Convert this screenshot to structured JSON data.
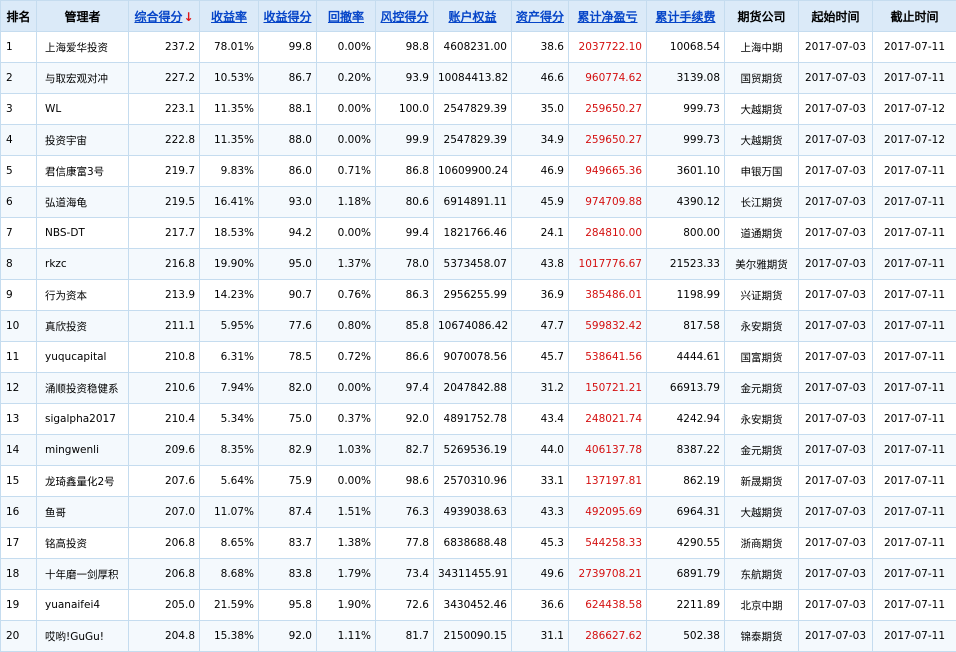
{
  "headers": {
    "rank": "排名",
    "manager": "管理者",
    "total_score": "综合得分",
    "sort_arrow": "↓",
    "return_rate": "收益率",
    "return_score": "收益得分",
    "drawdown": "回撤率",
    "risk_score": "风控得分",
    "equity": "账户权益",
    "asset_score": "资产得分",
    "net_profit": "累计净盈亏",
    "fees": "累计手续费",
    "company": "期货公司",
    "start_time": "起始时间",
    "end_time": "截止时间"
  },
  "colors": {
    "header_bg": "#dbeaf8",
    "link": "#0645c8",
    "sort_arrow": "#e01818",
    "profit": "#d41010",
    "grid": "#c5dcef"
  },
  "rows": [
    {
      "rank": "1",
      "manager": "上海爱华投资",
      "total_score": "237.2",
      "return_rate": "78.01%",
      "return_score": "99.8",
      "drawdown": "0.00%",
      "risk_score": "98.8",
      "equity": "4608231.00",
      "asset_score": "38.6",
      "net_profit": "2037722.10",
      "fees": "10068.54",
      "company": "上海中期",
      "start": "2017-07-03",
      "end": "2017-07-11"
    },
    {
      "rank": "2",
      "manager": "与取宏观对冲",
      "total_score": "227.2",
      "return_rate": "10.53%",
      "return_score": "86.7",
      "drawdown": "0.20%",
      "risk_score": "93.9",
      "equity": "10084413.82",
      "asset_score": "46.6",
      "net_profit": "960774.62",
      "fees": "3139.08",
      "company": "国贸期货",
      "start": "2017-07-03",
      "end": "2017-07-11"
    },
    {
      "rank": "3",
      "manager": "WL",
      "total_score": "223.1",
      "return_rate": "11.35%",
      "return_score": "88.1",
      "drawdown": "0.00%",
      "risk_score": "100.0",
      "equity": "2547829.39",
      "asset_score": "35.0",
      "net_profit": "259650.27",
      "fees": "999.73",
      "company": "大越期货",
      "start": "2017-07-03",
      "end": "2017-07-12"
    },
    {
      "rank": "4",
      "manager": "投资宇宙",
      "total_score": "222.8",
      "return_rate": "11.35%",
      "return_score": "88.0",
      "drawdown": "0.00%",
      "risk_score": "99.9",
      "equity": "2547829.39",
      "asset_score": "34.9",
      "net_profit": "259650.27",
      "fees": "999.73",
      "company": "大越期货",
      "start": "2017-07-03",
      "end": "2017-07-12"
    },
    {
      "rank": "5",
      "manager": "君信康富3号",
      "total_score": "219.7",
      "return_rate": "9.83%",
      "return_score": "86.0",
      "drawdown": "0.71%",
      "risk_score": "86.8",
      "equity": "10609900.24",
      "asset_score": "46.9",
      "net_profit": "949665.36",
      "fees": "3601.10",
      "company": "申银万国",
      "start": "2017-07-03",
      "end": "2017-07-11"
    },
    {
      "rank": "6",
      "manager": "弘道海龟",
      "total_score": "219.5",
      "return_rate": "16.41%",
      "return_score": "93.0",
      "drawdown": "1.18%",
      "risk_score": "80.6",
      "equity": "6914891.11",
      "asset_score": "45.9",
      "net_profit": "974709.88",
      "fees": "4390.12",
      "company": "长江期货",
      "start": "2017-07-03",
      "end": "2017-07-11"
    },
    {
      "rank": "7",
      "manager": "NBS-DT",
      "total_score": "217.7",
      "return_rate": "18.53%",
      "return_score": "94.2",
      "drawdown": "0.00%",
      "risk_score": "99.4",
      "equity": "1821766.46",
      "asset_score": "24.1",
      "net_profit": "284810.00",
      "fees": "800.00",
      "company": "道通期货",
      "start": "2017-07-03",
      "end": "2017-07-11"
    },
    {
      "rank": "8",
      "manager": "rkzc",
      "total_score": "216.8",
      "return_rate": "19.90%",
      "return_score": "95.0",
      "drawdown": "1.37%",
      "risk_score": "78.0",
      "equity": "5373458.07",
      "asset_score": "43.8",
      "net_profit": "1017776.67",
      "fees": "21523.33",
      "company": "美尔雅期货",
      "start": "2017-07-03",
      "end": "2017-07-11"
    },
    {
      "rank": "9",
      "manager": "行为资本",
      "total_score": "213.9",
      "return_rate": "14.23%",
      "return_score": "90.7",
      "drawdown": "0.76%",
      "risk_score": "86.3",
      "equity": "2956255.99",
      "asset_score": "36.9",
      "net_profit": "385486.01",
      "fees": "1198.99",
      "company": "兴证期货",
      "start": "2017-07-03",
      "end": "2017-07-11"
    },
    {
      "rank": "10",
      "manager": "真欣投资",
      "total_score": "211.1",
      "return_rate": "5.95%",
      "return_score": "77.6",
      "drawdown": "0.80%",
      "risk_score": "85.8",
      "equity": "10674086.42",
      "asset_score": "47.7",
      "net_profit": "599832.42",
      "fees": "817.58",
      "company": "永安期货",
      "start": "2017-07-03",
      "end": "2017-07-11"
    },
    {
      "rank": "11",
      "manager": "yuqucapital",
      "total_score": "210.8",
      "return_rate": "6.31%",
      "return_score": "78.5",
      "drawdown": "0.72%",
      "risk_score": "86.6",
      "equity": "9070078.56",
      "asset_score": "45.7",
      "net_profit": "538641.56",
      "fees": "4444.61",
      "company": "国富期货",
      "start": "2017-07-03",
      "end": "2017-07-11"
    },
    {
      "rank": "12",
      "manager": "涌顺投资稳健系",
      "total_score": "210.6",
      "return_rate": "7.94%",
      "return_score": "82.0",
      "drawdown": "0.00%",
      "risk_score": "97.4",
      "equity": "2047842.88",
      "asset_score": "31.2",
      "net_profit": "150721.21",
      "fees": "66913.79",
      "company": "金元期货",
      "start": "2017-07-03",
      "end": "2017-07-11"
    },
    {
      "rank": "13",
      "manager": "sigalpha2017",
      "total_score": "210.4",
      "return_rate": "5.34%",
      "return_score": "75.0",
      "drawdown": "0.37%",
      "risk_score": "92.0",
      "equity": "4891752.78",
      "asset_score": "43.4",
      "net_profit": "248021.74",
      "fees": "4242.94",
      "company": "永安期货",
      "start": "2017-07-03",
      "end": "2017-07-11"
    },
    {
      "rank": "14",
      "manager": "mingwenli",
      "total_score": "209.6",
      "return_rate": "8.35%",
      "return_score": "82.9",
      "drawdown": "1.03%",
      "risk_score": "82.7",
      "equity": "5269536.19",
      "asset_score": "44.0",
      "net_profit": "406137.78",
      "fees": "8387.22",
      "company": "金元期货",
      "start": "2017-07-03",
      "end": "2017-07-11"
    },
    {
      "rank": "15",
      "manager": "龙琦鑫量化2号",
      "total_score": "207.6",
      "return_rate": "5.64%",
      "return_score": "75.9",
      "drawdown": "0.00%",
      "risk_score": "98.6",
      "equity": "2570310.96",
      "asset_score": "33.1",
      "net_profit": "137197.81",
      "fees": "862.19",
      "company": "新晟期货",
      "start": "2017-07-03",
      "end": "2017-07-11"
    },
    {
      "rank": "16",
      "manager": "鱼哥",
      "total_score": "207.0",
      "return_rate": "11.07%",
      "return_score": "87.4",
      "drawdown": "1.51%",
      "risk_score": "76.3",
      "equity": "4939038.63",
      "asset_score": "43.3",
      "net_profit": "492095.69",
      "fees": "6964.31",
      "company": "大越期货",
      "start": "2017-07-03",
      "end": "2017-07-11"
    },
    {
      "rank": "17",
      "manager": "铭高投资",
      "total_score": "206.8",
      "return_rate": "8.65%",
      "return_score": "83.7",
      "drawdown": "1.38%",
      "risk_score": "77.8",
      "equity": "6838688.48",
      "asset_score": "45.3",
      "net_profit": "544258.33",
      "fees": "4290.55",
      "company": "浙商期货",
      "start": "2017-07-03",
      "end": "2017-07-11"
    },
    {
      "rank": "18",
      "manager": "十年磨一剑厚积",
      "total_score": "206.8",
      "return_rate": "8.68%",
      "return_score": "83.8",
      "drawdown": "1.79%",
      "risk_score": "73.4",
      "equity": "34311455.91",
      "asset_score": "49.6",
      "net_profit": "2739708.21",
      "fees": "6891.79",
      "company": "东航期货",
      "start": "2017-07-03",
      "end": "2017-07-11"
    },
    {
      "rank": "19",
      "manager": "yuanaifei4",
      "total_score": "205.0",
      "return_rate": "21.59%",
      "return_score": "95.8",
      "drawdown": "1.90%",
      "risk_score": "72.6",
      "equity": "3430452.46",
      "asset_score": "36.6",
      "net_profit": "624438.58",
      "fees": "2211.89",
      "company": "北京中期",
      "start": "2017-07-03",
      "end": "2017-07-11"
    },
    {
      "rank": "20",
      "manager": "哎哟!GuGu!",
      "total_score": "204.8",
      "return_rate": "15.38%",
      "return_score": "92.0",
      "drawdown": "1.11%",
      "risk_score": "81.7",
      "equity": "2150090.15",
      "asset_score": "31.1",
      "net_profit": "286627.62",
      "fees": "502.38",
      "company": "锦泰期货",
      "start": "2017-07-03",
      "end": "2017-07-11"
    }
  ]
}
